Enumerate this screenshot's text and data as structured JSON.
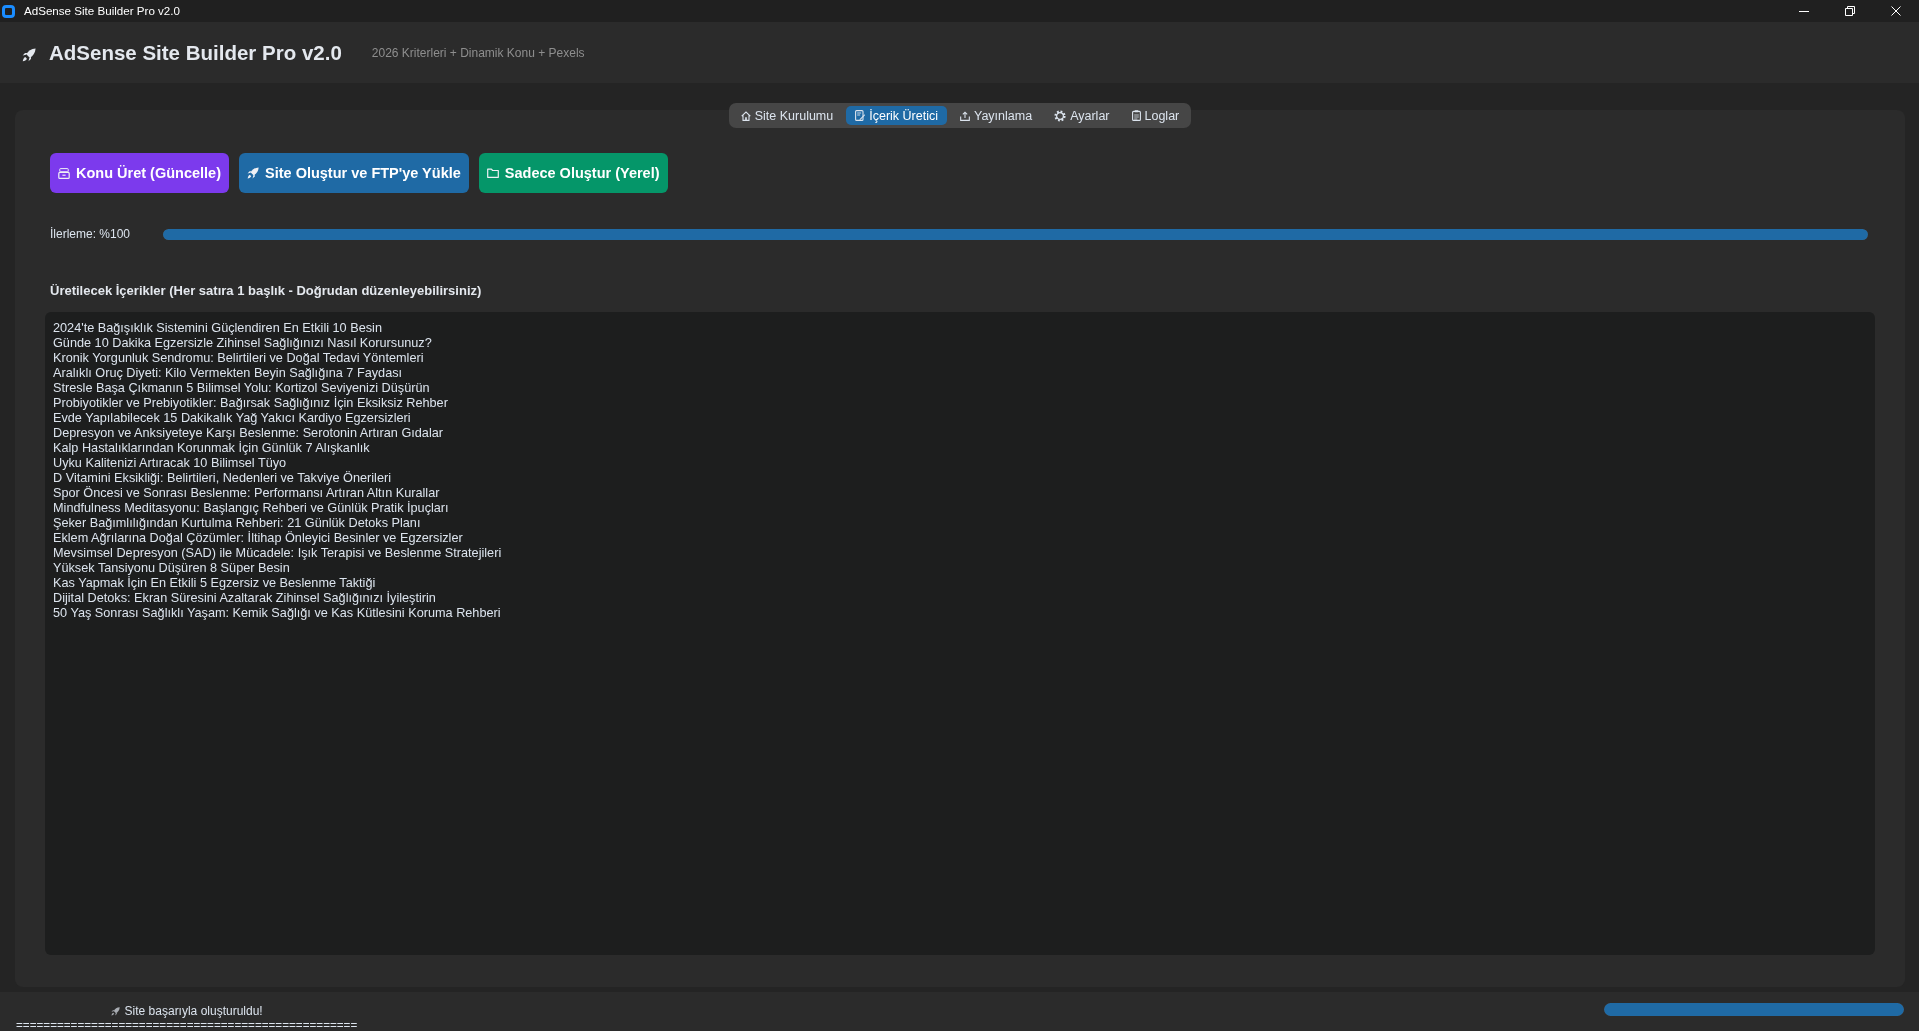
{
  "window": {
    "title": "AdSense Site Builder Pro v2.0"
  },
  "header": {
    "title": "AdSense Site Builder Pro v2.0",
    "subtitle": "2026 Kriterleri + Dinamik Konu + Pexels"
  },
  "tabs": [
    {
      "label": "Site Kurulumu",
      "selected": false
    },
    {
      "label": "İçerik Üretici",
      "selected": true
    },
    {
      "label": "Yayınlama",
      "selected": false
    },
    {
      "label": "Ayarlar",
      "selected": false
    },
    {
      "label": "Loglar",
      "selected": false
    }
  ],
  "actions": [
    {
      "label": "Konu Üret (Güncelle)",
      "color": "#7c3aed"
    },
    {
      "label": "Site Oluştur ve FTP'ye Yükle",
      "color": "#1f6aa5"
    },
    {
      "label": "Sadece Oluştur (Yerel)",
      "color": "#059669"
    }
  ],
  "progress": {
    "label": "İlerleme: %100",
    "level": 1
  },
  "topics": {
    "label": "Üretilecek İçerikler (Her satıra 1 başlık - Doğrudan düzenleyebilirsiniz)",
    "lines": [
      "2024'te Bağışıklık Sistemini Güçlendiren En Etkili 10 Besin",
      "Günde 10 Dakika Egzersizle Zihinsel Sağlığınızı Nasıl Korursunuz?",
      "Kronik Yorgunluk Sendromu: Belirtileri ve Doğal Tedavi Yöntemleri",
      "Aralıklı Oruç Diyeti: Kilo Vermekten Beyin Sağlığına 7 Faydası",
      "Stresle Başa Çıkmanın 5 Bilimsel Yolu: Kortizol Seviyenizi Düşürün",
      "Probiyotikler ve Prebiyotikler: Bağırsak Sağlığınız İçin Eksiksiz Rehber",
      "Evde Yapılabilecek 15 Dakikalık Yağ Yakıcı Kardiyo Egzersizleri",
      "Depresyon ve Anksiyeteye Karşı Beslenme: Serotonin Artıran Gıdalar",
      "Kalp Hastalıklarından Korunmak İçin Günlük 7 Alışkanlık",
      "Uyku Kalitenizi Artıracak 10 Bilimsel Tüyo",
      "D Vitamini Eksikliği: Belirtileri, Nedenleri ve Takviye Önerileri",
      "Spor Öncesi ve Sonrası Beslenme: Performansı Artıran Altın Kurallar",
      "Mindfulness Meditasyonu: Başlangıç Rehberi ve Günlük Pratik İpuçları",
      "Şeker Bağımlılığından Kurtulma Rehberi: 21 Günlük Detoks Planı",
      "Eklem Ağrılarına Doğal Çözümler: İltihap Önleyici Besinler ve Egzersizler",
      "Mevsimsel Depresyon (SAD) ile Mücadele: Işık Terapisi ve Beslenme Stratejileri",
      "Yüksek Tansiyonu Düşüren 8 Süper Besin",
      "Kas Yapmak İçin En Etkili 5 Egzersiz ve Beslenme Taktiği",
      "Dijital Detoks: Ekran Süresini Azaltarak Zihinsel Sağlığınızı İyileştirin",
      "50 Yaş Sonrası Sağlıklı Yaşam: Kemik Sağlığı ve Kas Kütlesini Koruma Rehberi"
    ]
  },
  "status_bar": {
    "message": "Site başarıyla oluşturuldu!",
    "log_line": "==================================================",
    "level": 1
  }
}
